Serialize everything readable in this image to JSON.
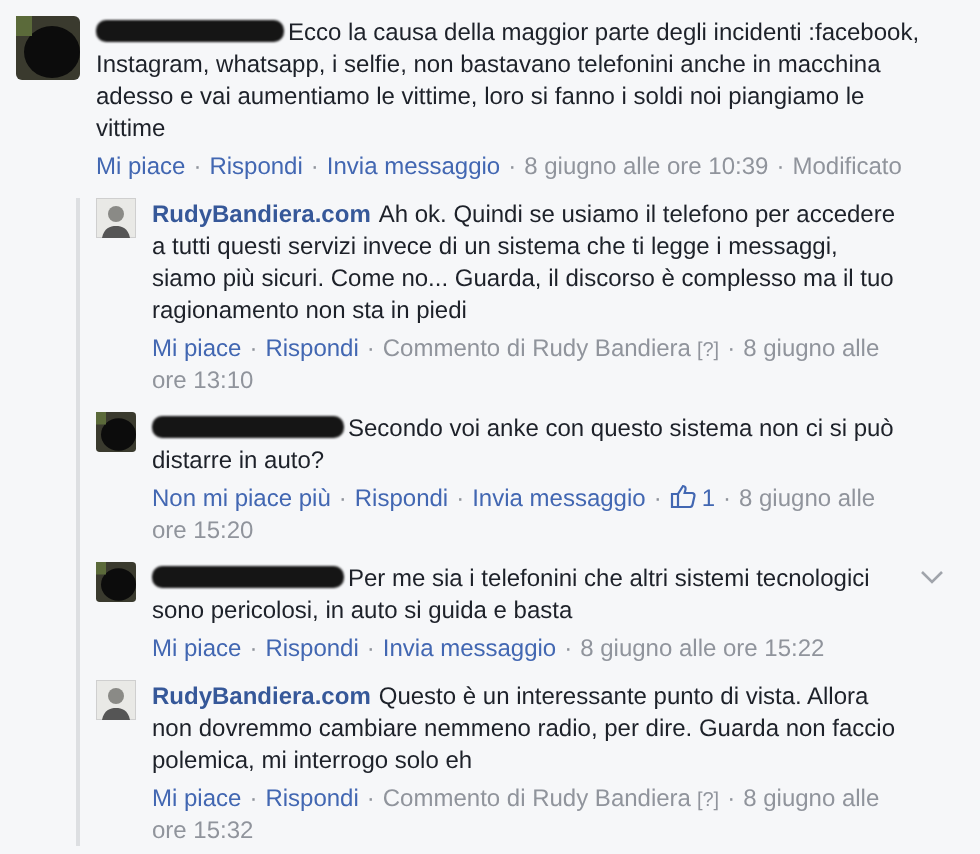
{
  "separator": "·",
  "comment": {
    "kind": "redacted",
    "text": "Ecco la causa della maggior parte degli incidenti :facebook, Instagram, whatsapp, i selfie, non bastavano telefonini anche in macchina adesso e vai aumentiamo le vittime, loro si fanno i soldi noi piangiamo le vittime",
    "chevron": false,
    "actions": [
      {
        "kind": "link",
        "text": "Mi piace"
      },
      {
        "kind": "link",
        "text": "Rispondi"
      },
      {
        "kind": "link",
        "text": "Invia messaggio"
      },
      {
        "kind": "meta",
        "text": "8 giugno alle ore 10:39"
      },
      {
        "kind": "meta",
        "text": "Modificato"
      }
    ]
  },
  "replies": [
    {
      "kind": "named",
      "author": "RudyBandiera.com",
      "text": "Ah ok. Quindi se usiamo il telefono per accedere a tutti questi servizi invece di un sistema che ti legge i messaggi, siamo più sicuri. Come no... Guarda, il discorso è complesso ma il tuo ragionamento non sta in piedi",
      "chevron": false,
      "actions": [
        {
          "kind": "link",
          "text": "Mi piace"
        },
        {
          "kind": "link",
          "text": "Rispondi"
        },
        {
          "kind": "meta",
          "text": "Commento di Rudy Bandiera",
          "help": "[?]"
        },
        {
          "kind": "meta",
          "text": "8 giugno alle ore 13:10"
        }
      ]
    },
    {
      "kind": "redacted",
      "text": "Secondo voi anke con questo sistema non ci si può distarre in auto?",
      "chevron": false,
      "actions": [
        {
          "kind": "link",
          "text": "Non mi piace più"
        },
        {
          "kind": "link",
          "text": "Rispondi"
        },
        {
          "kind": "link",
          "text": "Invia messaggio"
        },
        {
          "kind": "likes",
          "text": "1"
        },
        {
          "kind": "meta",
          "text": "8 giugno alle ore 15:20"
        }
      ]
    },
    {
      "kind": "redacted",
      "text": "Per me sia i telefonini che altri sistemi tecnologici sono pericolosi, in auto si guida e basta",
      "chevron": true,
      "actions": [
        {
          "kind": "link",
          "text": "Mi piace"
        },
        {
          "kind": "link",
          "text": "Rispondi"
        },
        {
          "kind": "link",
          "text": "Invia messaggio"
        },
        {
          "kind": "meta",
          "text": "8 giugno alle ore 15:22"
        }
      ]
    },
    {
      "kind": "named",
      "author": "RudyBandiera.com",
      "text": "Questo è un interessante punto di vista. Allora non dovremmo cambiare nemmeno radio, per dire. Guarda non faccio polemica, mi interrogo solo eh",
      "chevron": false,
      "actions": [
        {
          "kind": "link",
          "text": "Mi piace"
        },
        {
          "kind": "link",
          "text": "Rispondi"
        },
        {
          "kind": "meta",
          "text": "Commento di Rudy Bandiera",
          "help": "[?]"
        },
        {
          "kind": "meta",
          "text": "8 giugno alle ore 15:32"
        }
      ]
    }
  ]
}
